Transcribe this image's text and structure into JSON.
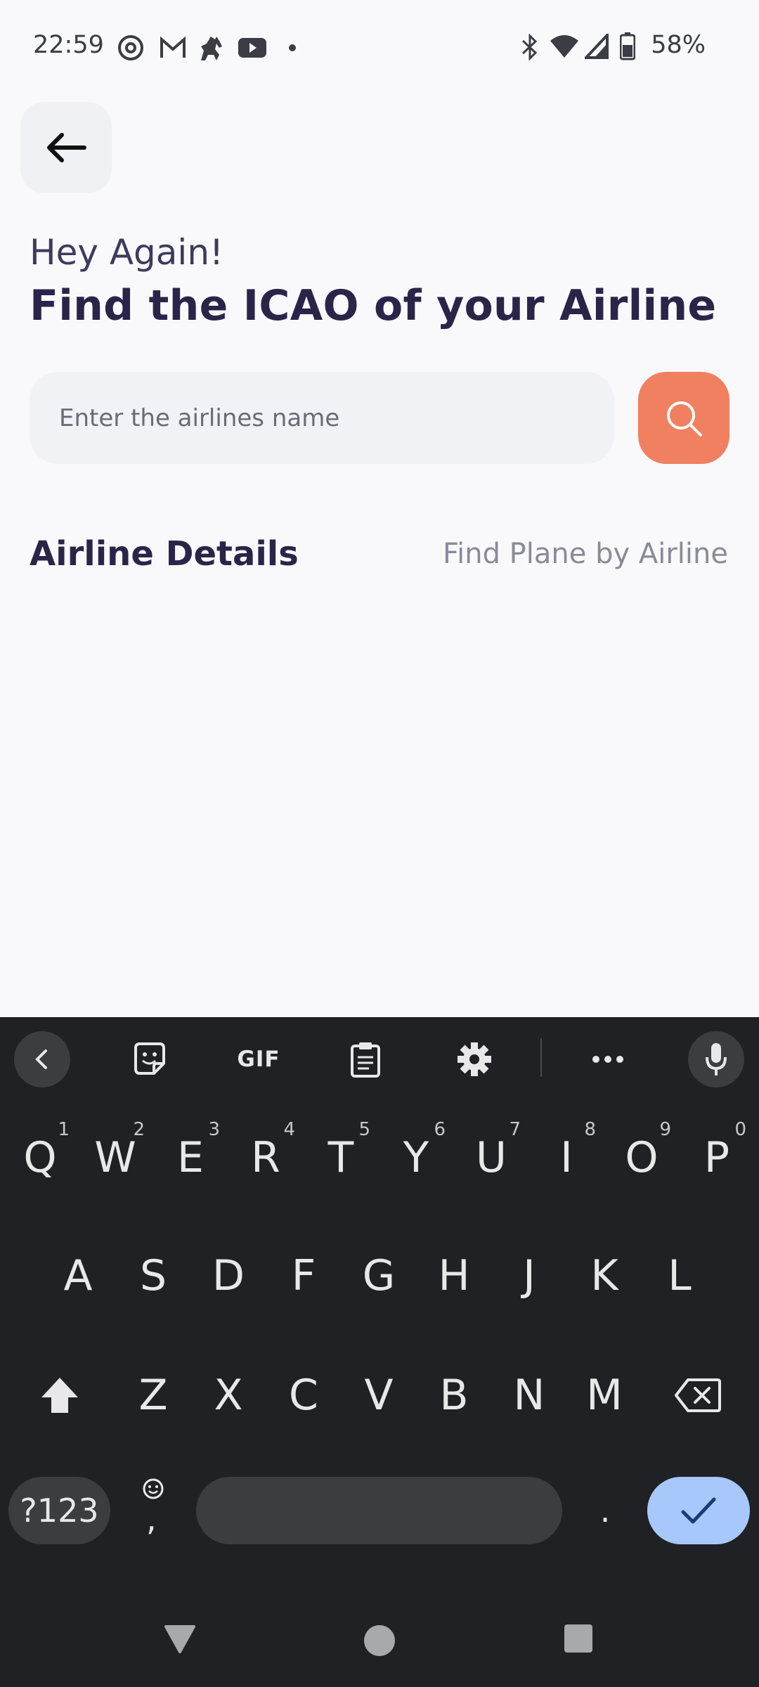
{
  "status_bar": {
    "time": "22:59",
    "battery": "58%",
    "left_icons": [
      "threads-icon",
      "gmail-icon",
      "horse-app-icon",
      "youtube-icon",
      "dot-icon"
    ],
    "right_icons": [
      "bluetooth-icon",
      "wifi-icon",
      "signal-icon",
      "battery-icon"
    ]
  },
  "header": {
    "greeting": "Hey Again!",
    "title": "Find the ICAO of your Airline"
  },
  "search": {
    "placeholder": "Enter the airlines name",
    "value": ""
  },
  "section": {
    "title": "Airline Details",
    "link": "Find Plane by Airline"
  },
  "keyboard": {
    "toolbar": {
      "gif_label": "GIF"
    },
    "row1": [
      {
        "key": "Q",
        "hint": "1"
      },
      {
        "key": "W",
        "hint": "2"
      },
      {
        "key": "E",
        "hint": "3"
      },
      {
        "key": "R",
        "hint": "4"
      },
      {
        "key": "T",
        "hint": "5"
      },
      {
        "key": "Y",
        "hint": "6"
      },
      {
        "key": "U",
        "hint": "7"
      },
      {
        "key": "I",
        "hint": "8"
      },
      {
        "key": "O",
        "hint": "9"
      },
      {
        "key": "P",
        "hint": "0"
      }
    ],
    "row2": [
      "A",
      "S",
      "D",
      "F",
      "G",
      "H",
      "J",
      "K",
      "L"
    ],
    "row3": [
      "Z",
      "X",
      "C",
      "V",
      "B",
      "N",
      "M"
    ],
    "symbols_label": "?123",
    "comma": ",",
    "period": "."
  },
  "colors": {
    "accent": "#f08060",
    "title": "#2a2548",
    "keyboard_bg": "#202124",
    "enter_key": "#a8c7fa"
  }
}
